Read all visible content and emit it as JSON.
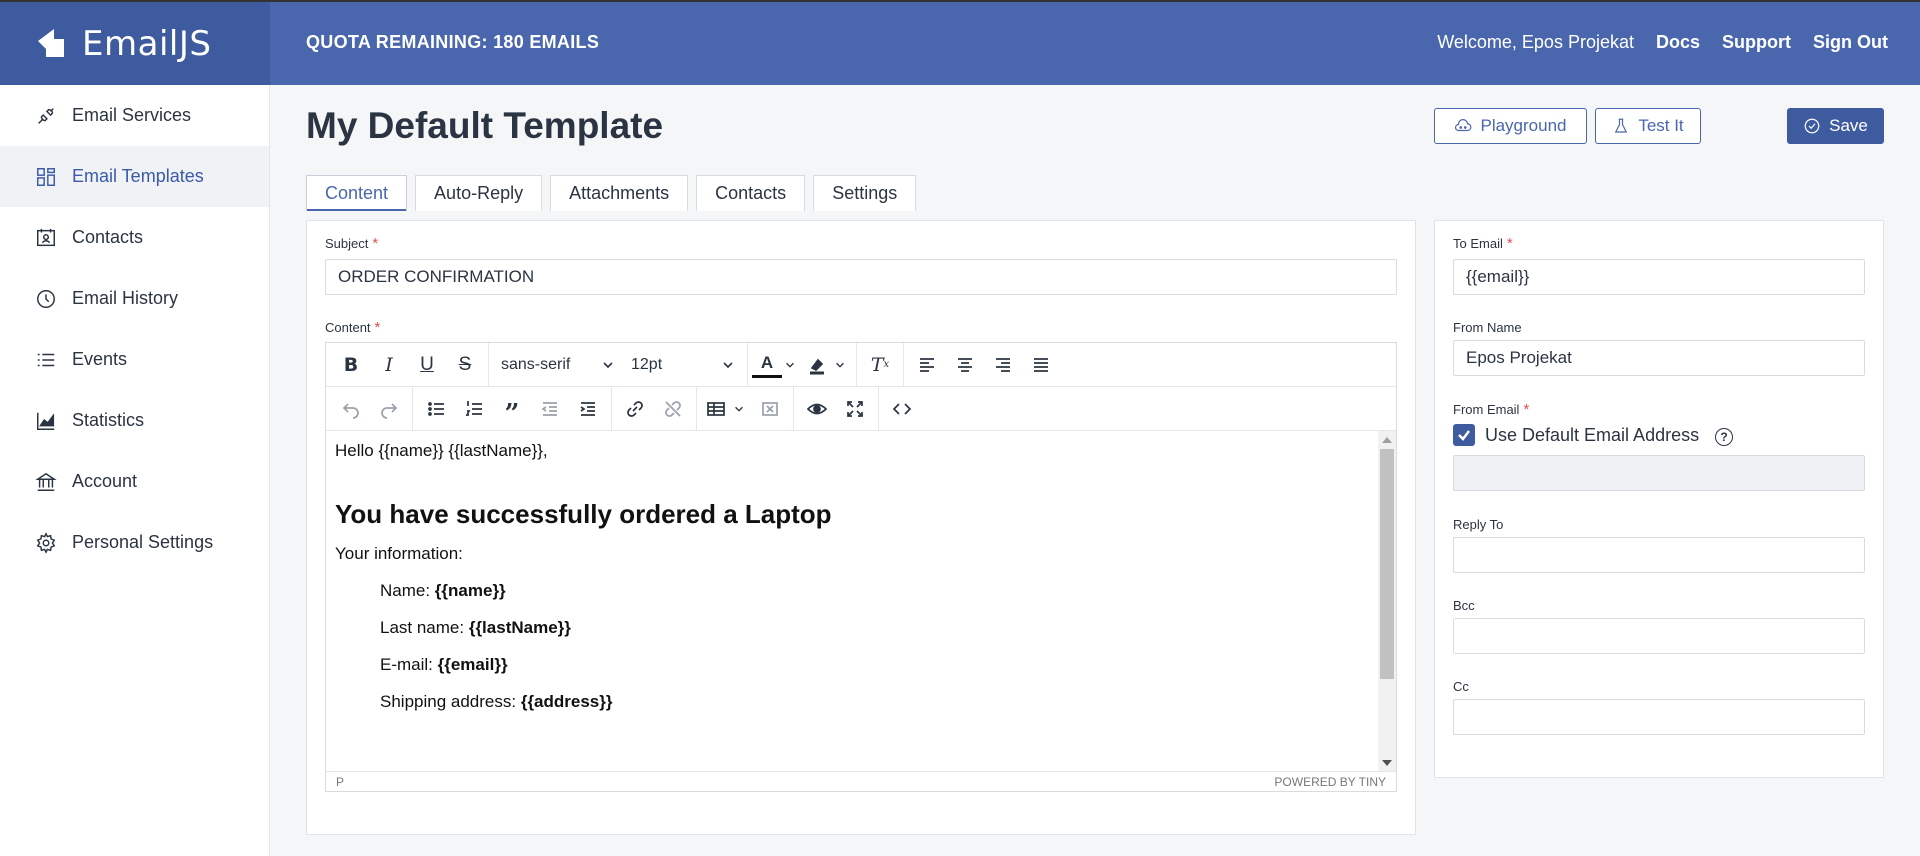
{
  "app": {
    "name": "EmailJS"
  },
  "topbar": {
    "quota": "QUOTA REMAINING: 180 EMAILS",
    "welcome": "Welcome,  Epos Projekat",
    "docs": "Docs",
    "support": "Support",
    "signout": "Sign Out"
  },
  "sidebar": {
    "items": [
      {
        "label": "Email Services",
        "icon": "plug-icon"
      },
      {
        "label": "Email Templates",
        "icon": "templates-icon",
        "active": true
      },
      {
        "label": "Contacts",
        "icon": "contacts-icon"
      },
      {
        "label": "Email History",
        "icon": "history-icon"
      },
      {
        "label": "Events",
        "icon": "list-icon"
      },
      {
        "label": "Statistics",
        "icon": "chart-icon"
      },
      {
        "label": "Account",
        "icon": "bank-icon"
      },
      {
        "label": "Personal Settings",
        "icon": "gear-icon"
      }
    ]
  },
  "page": {
    "title": "My Default Template",
    "playground": "Playground",
    "test_it": "Test It",
    "save": "Save"
  },
  "tabs": [
    "Content",
    "Auto-Reply",
    "Attachments",
    "Contacts",
    "Settings"
  ],
  "form": {
    "subject_label": "Subject",
    "subject_value": "ORDER CONFIRMATION",
    "content_label": "Content",
    "req": "*"
  },
  "editor": {
    "font_family": "sans-serif",
    "font_size": "12pt",
    "greeting": "Hello {{name}} {{lastName}},",
    "heading": "You have successfully ordered a Laptop",
    "info": "Your information:",
    "rows": [
      {
        "label": "Name: ",
        "value": "{{name}}"
      },
      {
        "label": "Last name: ",
        "value": "{{lastName}}"
      },
      {
        "label": "E-mail: ",
        "value": "{{email}}"
      },
      {
        "label": "Shipping address: ",
        "value": "{{address}}"
      }
    ],
    "status_path": "P",
    "powered_by": "POWERED BY TINY"
  },
  "right": {
    "to_email_label": "To Email",
    "to_email_value": "{{email}}",
    "from_name_label": "From Name",
    "from_name_value": "Epos Projekat",
    "from_email_label": "From Email",
    "use_default_label": "Use Default Email Address",
    "help": "?",
    "reply_to_label": "Reply To",
    "bcc_label": "Bcc",
    "cc_label": "Cc"
  },
  "colors": {
    "brand": "#4a67ad",
    "brand_dark": "#3f5ba0",
    "required": "#e05252"
  }
}
